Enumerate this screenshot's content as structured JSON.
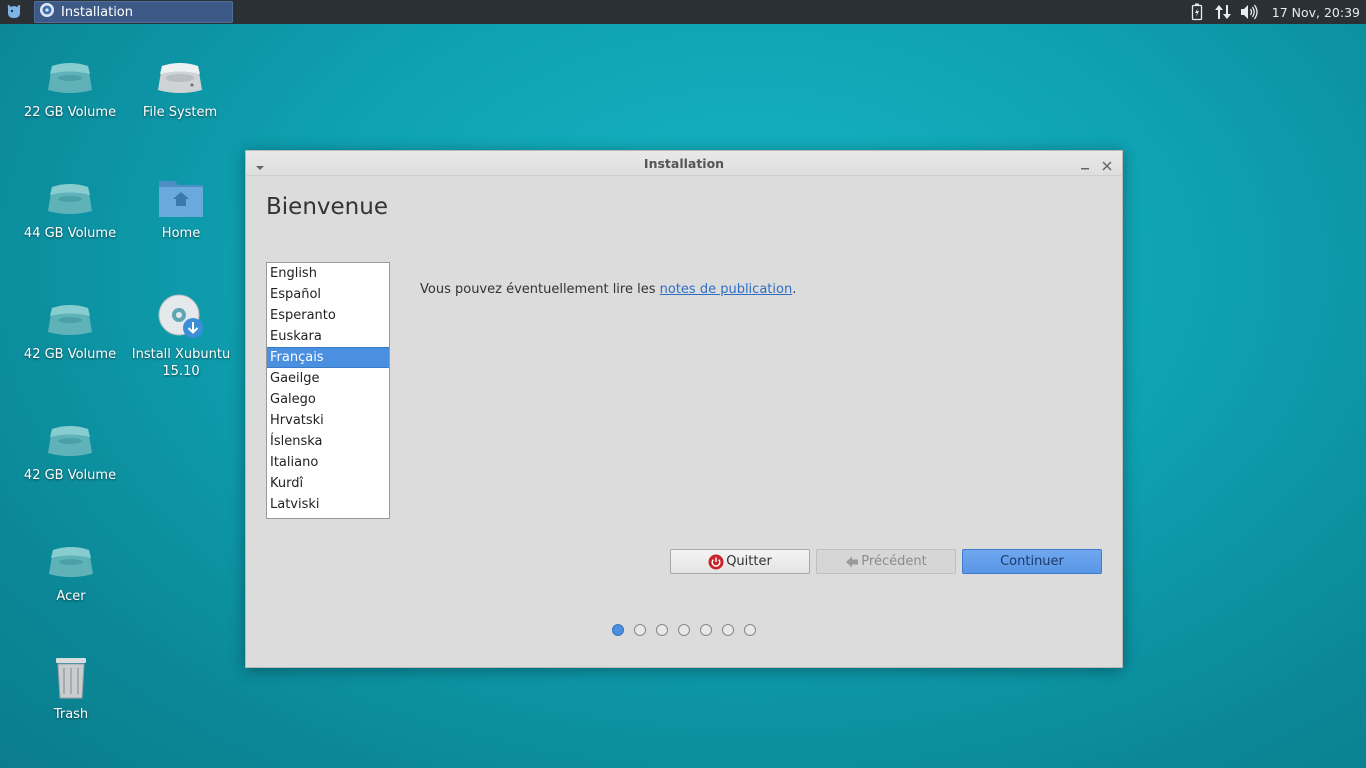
{
  "panel": {
    "task_title": "Installation",
    "clock": "17 Nov, 20:39",
    "icons": [
      "xfce-menu-icon",
      "battery-icon",
      "network-icon",
      "volume-icon"
    ]
  },
  "desktop": {
    "icons": [
      {
        "label": "22 GB Volume",
        "icon": "drive-icon"
      },
      {
        "label": "File System",
        "icon": "harddisk-icon"
      },
      {
        "label": "44 GB Volume",
        "icon": "drive-icon"
      },
      {
        "label": "Home",
        "icon": "home-folder-icon"
      },
      {
        "label": "42 GB Volume",
        "icon": "drive-icon"
      },
      {
        "label": "Install Xubuntu 15.10",
        "icon": "install-disc-icon"
      },
      {
        "label": "42 GB Volume",
        "icon": "drive-icon"
      },
      {
        "label": "Acer",
        "icon": "drive-icon"
      },
      {
        "label": "Trash",
        "icon": "trash-icon"
      }
    ]
  },
  "dialog": {
    "title": "Installation",
    "heading": "Bienvenue",
    "languages": [
      "English",
      "Español",
      "Esperanto",
      "Euskara",
      "Français",
      "Gaeilge",
      "Galego",
      "Hrvatski",
      "Íslenska",
      "Italiano",
      "Kurdî",
      "Latviski"
    ],
    "selected_language": "Français",
    "notes_text": "Vous pouvez éventuellement lire les ",
    "notes_link": "notes de publication",
    "notes_end": ".",
    "buttons": {
      "quit": "Quitter",
      "previous": "Précédent",
      "continue": "Continuer"
    },
    "steps_total": 7,
    "step_current": 1
  },
  "colors": {
    "accent": "#4a8fe0",
    "desktop_bg": "#0ea0b0",
    "panel_bg": "#2b3035"
  }
}
